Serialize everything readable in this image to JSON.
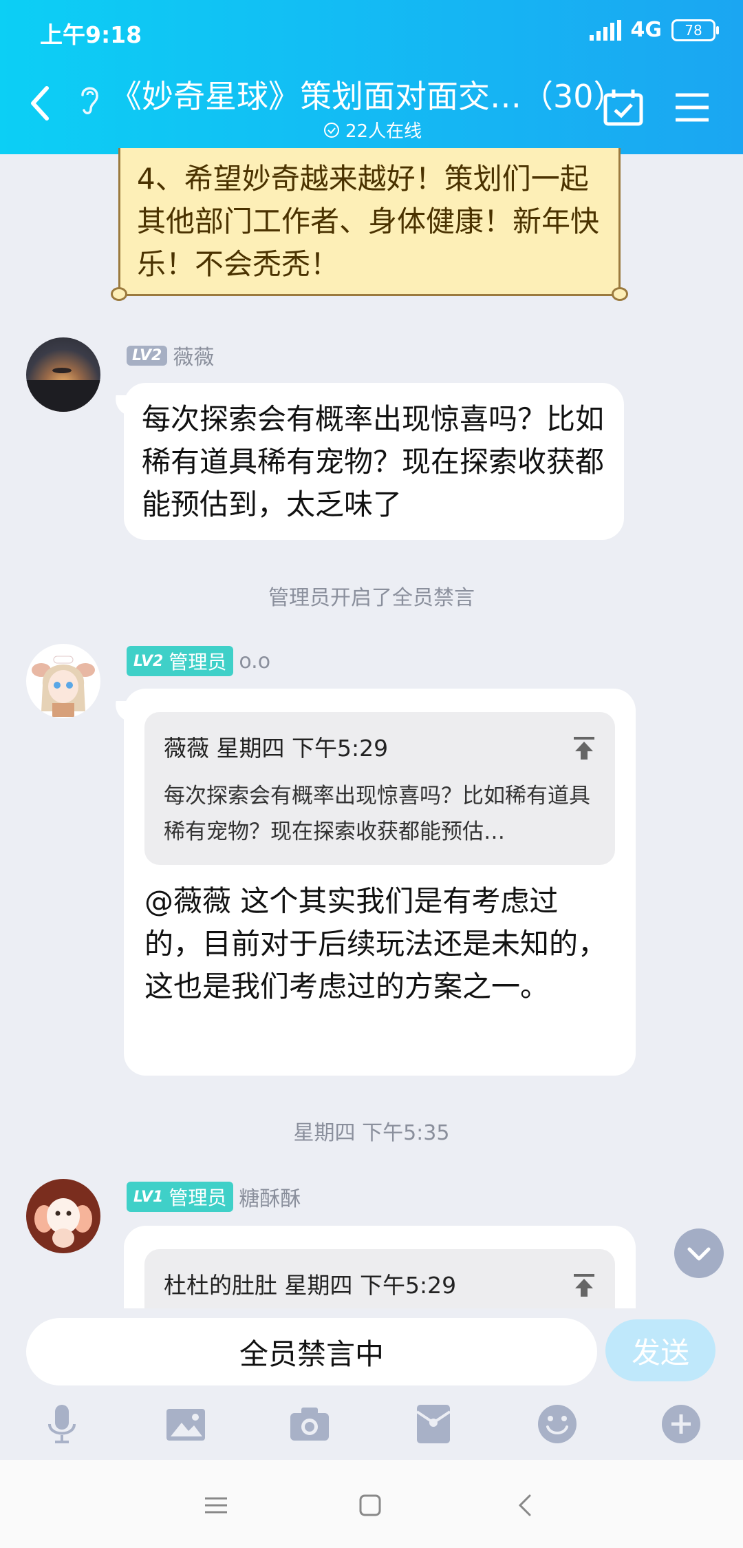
{
  "status": {
    "time": "上午9:18",
    "network": "4G",
    "battery": "78"
  },
  "header": {
    "title": "《妙奇星球》策划面对面交…（30）",
    "online": "22人在线"
  },
  "notice": {
    "text": "4、希望妙奇越来越好！策划们一起其他部门工作者、身体健康！新年快乐！不会秃秃！"
  },
  "messages": [
    {
      "level": "LV2",
      "role": "",
      "name": "薇薇",
      "text": "每次探索会有概率出现惊喜吗？比如稀有道具稀有宠物？现在探索收获都能预估到，太乏味了"
    },
    {
      "level": "LV2",
      "role": "管理员",
      "name": "o.o",
      "quote": {
        "header": "薇薇  星期四  下午5:29",
        "text": "每次探索会有概率出现惊喜吗？比如稀有道具稀有宠物？现在探索收获都能预估…"
      },
      "text": "@薇薇 这个其实我们是有考虑过的，目前对于后续玩法还是未知的，这也是我们考虑过的方案之一。"
    },
    {
      "level": "LV1",
      "role": "管理员",
      "name": "糖酥酥",
      "quote": {
        "header": "杜杜的肚肚  星期四  下午5:29"
      }
    }
  ],
  "system": {
    "mute_notice": "管理员开启了全员禁言",
    "time_divider": "星期四 下午5:35"
  },
  "composer": {
    "placeholder": "全员禁言中",
    "send": "发送"
  },
  "toolbar": {
    "icons": [
      "mic-icon",
      "image-icon",
      "camera-icon",
      "red-packet-icon",
      "emoji-icon",
      "plus-icon"
    ]
  }
}
